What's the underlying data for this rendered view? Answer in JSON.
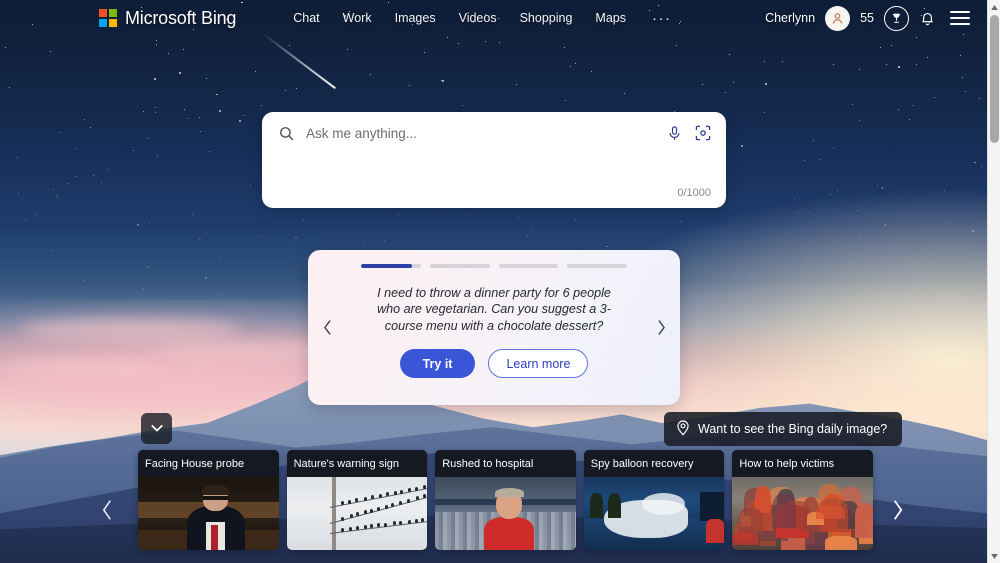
{
  "header": {
    "logo_text": "Microsoft Bing",
    "logo_icon": "microsoft-squares-logo",
    "logo_colors": [
      "#f25022",
      "#7fba00",
      "#00a4ef",
      "#ffb900"
    ],
    "nav_items": [
      {
        "label": "Chat",
        "name": "nav-item-chat"
      },
      {
        "label": "Work",
        "name": "nav-item-work"
      },
      {
        "label": "Images",
        "name": "nav-item-images"
      },
      {
        "label": "Videos",
        "name": "nav-item-videos"
      },
      {
        "label": "Shopping",
        "name": "nav-item-shopping"
      },
      {
        "label": "Maps",
        "name": "nav-item-maps"
      }
    ],
    "nav_more_label": "···",
    "user_name": "Cherlynn",
    "avatar_icon": "person-avatar-icon",
    "rewards_points": "55",
    "rewards_icon": "trophy-rewards-icon",
    "notifications_icon": "bell-icon",
    "menu_icon": "hamburger-menu-icon"
  },
  "search": {
    "placeholder": "Ask me anything...",
    "value": "",
    "search_icon": "search-icon",
    "mic_icon": "microphone-icon",
    "visual_search_icon": "visual-search-camera-icon",
    "counter": "0/1000",
    "max_chars": 1000
  },
  "carousel": {
    "progress_segments": [
      85,
      0,
      0,
      0
    ],
    "active_index": 0,
    "accent_color": "#2f3fa8",
    "prompt": "I need to throw a dinner party for 6 people who are vegetarian. Can you suggest a 3-course menu with a chocolate dessert?",
    "try_it_label": "Try it",
    "learn_more_label": "Learn more",
    "prev_icon": "chevron-left-icon",
    "next_icon": "chevron-right-icon",
    "primary_color": "#3b55d9"
  },
  "daily_image_pill": {
    "label": "Want to see the Bing daily image?",
    "icon": "location-pin-icon"
  },
  "collapse_toggle": {
    "icon": "chevron-down-icon"
  },
  "news": {
    "prev_icon": "chevron-left-icon",
    "next_icon": "chevron-right-icon",
    "cards": [
      {
        "title": "Facing House probe",
        "thumb": "th1",
        "name": "news-card-facing-house-probe"
      },
      {
        "title": "Nature's warning sign",
        "thumb": "th2",
        "name": "news-card-natures-warning-sign"
      },
      {
        "title": "Rushed to hospital",
        "thumb": "th3",
        "name": "news-card-rushed-to-hospital"
      },
      {
        "title": "Spy balloon recovery",
        "thumb": "th4",
        "name": "news-card-spy-balloon-recovery"
      },
      {
        "title": "How to help victims",
        "thumb": "th5",
        "name": "news-card-how-to-help-victims"
      }
    ]
  },
  "scrollbar": {
    "up_icon": "scroll-up-arrow-icon",
    "down_icon": "scroll-down-arrow-icon",
    "thumb": "scrollbar-thumb"
  },
  "background": {
    "description": "mountain-sunset-wallpaper"
  }
}
